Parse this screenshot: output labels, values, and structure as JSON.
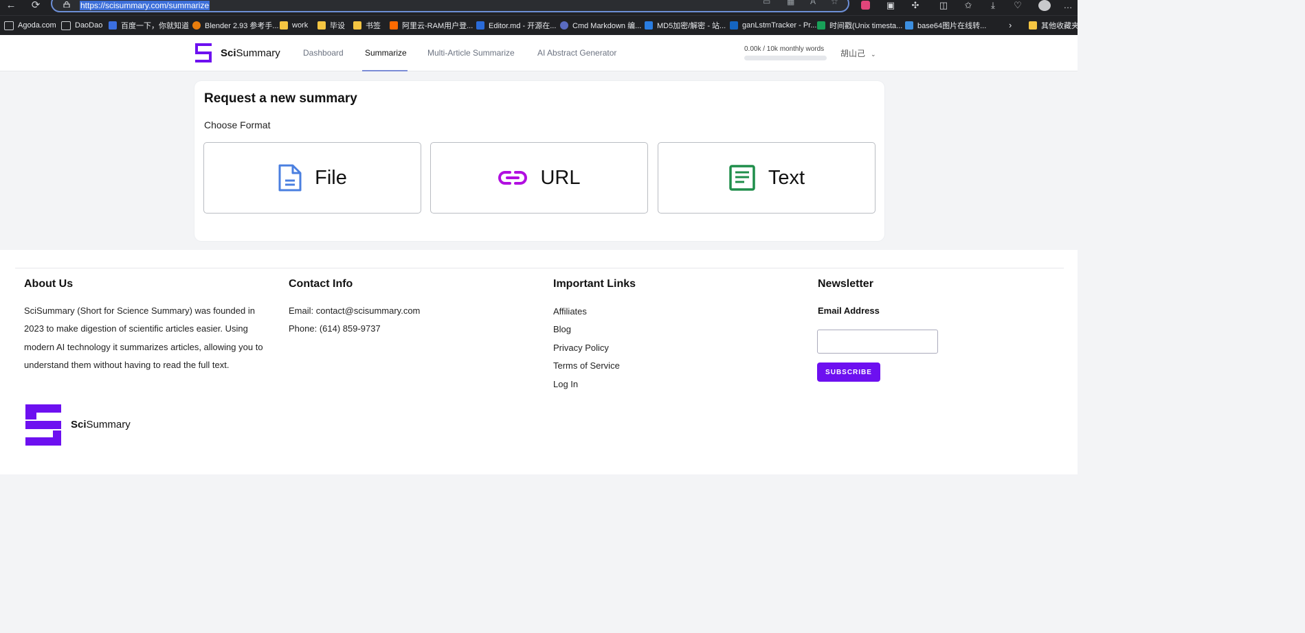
{
  "browser": {
    "url": "https://scisummary.com/summarize",
    "bookmarks": [
      {
        "label": "Agoda.com",
        "icon": "page-icon"
      },
      {
        "label": "DaoDao",
        "icon": "page-icon"
      },
      {
        "label": "百度一下，你就知道",
        "icon": "baidu-icon"
      },
      {
        "label": "Blender 2.93 参考手...",
        "icon": "blender-icon"
      },
      {
        "label": "work",
        "icon": "folder-icon"
      },
      {
        "label": "毕设",
        "icon": "folder-icon"
      },
      {
        "label": "书签",
        "icon": "folder-icon"
      },
      {
        "label": "阿里云-RAM用户登...",
        "icon": "aliyun-icon"
      },
      {
        "label": "Editor.md - 开源在...",
        "icon": "editormd-icon"
      },
      {
        "label": "Cmd Markdown 编...",
        "icon": "cmd-markdown-icon"
      },
      {
        "label": "MD5加密/解密 - 站...",
        "icon": "md5-icon"
      },
      {
        "label": "ganLstmTracker - Pr...",
        "icon": "on-icon"
      },
      {
        "label": "时间戳(Unix timesta...",
        "icon": "timestamp-icon"
      },
      {
        "label": "base64图片在线转...",
        "icon": "base64-icon"
      },
      {
        "label": "其他收藏夹",
        "icon": "folder-icon"
      }
    ]
  },
  "header": {
    "logo_bold": "Sci",
    "logo_rest": "Summary",
    "nav": [
      {
        "label": "Dashboard",
        "active": false
      },
      {
        "label": "Summarize",
        "active": true
      },
      {
        "label": "Multi-Article Summarize",
        "active": false
      },
      {
        "label": "AI Abstract Generator",
        "active": false
      }
    ],
    "quota_label": "0.00k / 10k monthly words",
    "quota_fraction": 0.0,
    "user_name": "胡山己"
  },
  "main": {
    "title": "Request a new summary",
    "subtitle": "Choose Format",
    "formats": [
      {
        "label": "File",
        "icon": "file-icon",
        "color": "#4a7fe0"
      },
      {
        "label": "URL",
        "icon": "link-icon",
        "color": "#b10fe0"
      },
      {
        "label": "Text",
        "icon": "text-document-icon",
        "color": "#1f8e4a"
      }
    ]
  },
  "footer": {
    "about": {
      "title": "About Us",
      "text": "SciSummary (Short for Science Summary) was founded in 2023 to make digestion of scientific articles easier. Using modern AI technology it summarizes articles, allowing you to understand them without having to read the full text."
    },
    "contact": {
      "title": "Contact Info",
      "email": "Email: contact@scisummary.com",
      "phone": "Phone: (614) 859-9737"
    },
    "links": {
      "title": "Important Links",
      "items": [
        "Affiliates",
        "Blog",
        "Privacy Policy",
        "Terms of Service",
        "Log In"
      ]
    },
    "newsletter": {
      "title": "Newsletter",
      "email_label": "Email Address",
      "button": "SUBSCRIBE"
    },
    "logo_bold": "Sci",
    "logo_rest": "Summary"
  },
  "colors": {
    "brand": "#6d10f0",
    "file": "#4a7fe0",
    "url": "#b10fe0",
    "text": "#1f8e4a"
  }
}
